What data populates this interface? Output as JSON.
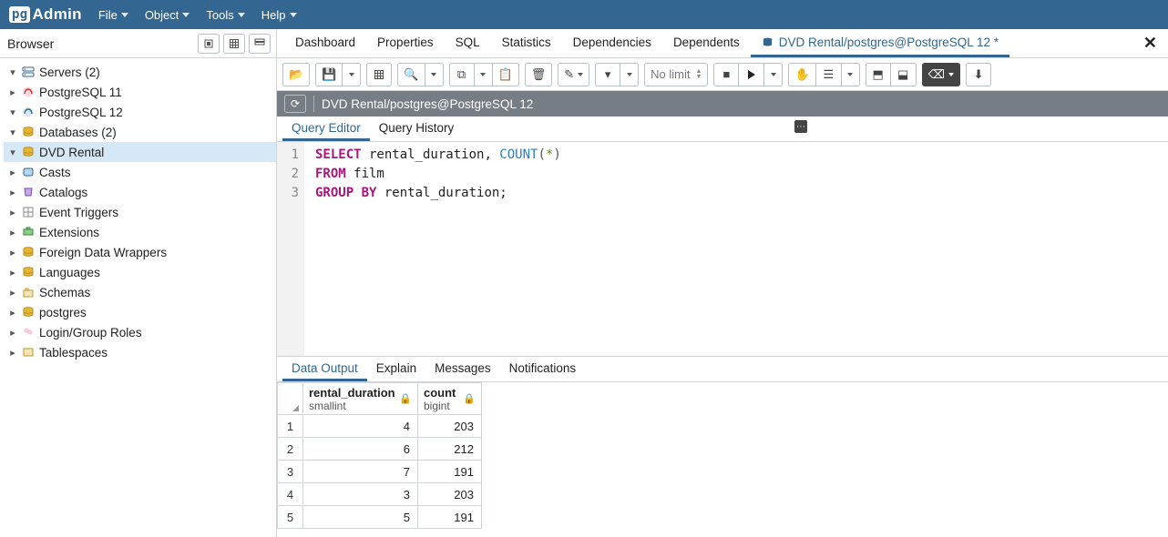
{
  "menubar": {
    "logo_prefix": "pg",
    "logo_suffix": "Admin",
    "items": [
      "File",
      "Object",
      "Tools",
      "Help"
    ]
  },
  "sidebar": {
    "title": "Browser",
    "tree": [
      {
        "lv": 0,
        "toggle": "▾",
        "icon": "servers",
        "label": "Servers (2)"
      },
      {
        "lv": 1,
        "toggle": "▸",
        "icon": "elephant-red",
        "label": "PostgreSQL 11"
      },
      {
        "lv": 1,
        "toggle": "▾",
        "icon": "elephant-blue",
        "label": "PostgreSQL 12"
      },
      {
        "lv": 2,
        "toggle": "▾",
        "icon": "db-group",
        "label": "Databases (2)"
      },
      {
        "lv": 3,
        "toggle": "▾",
        "icon": "db-gold",
        "label": "DVD Rental",
        "selected": true
      },
      {
        "lv": 4,
        "toggle": "▸",
        "icon": "casts",
        "label": "Casts"
      },
      {
        "lv": 4,
        "toggle": "▸",
        "icon": "catalogs",
        "label": "Catalogs"
      },
      {
        "lv": 4,
        "toggle": "▸",
        "icon": "event-trig",
        "label": "Event Triggers"
      },
      {
        "lv": 4,
        "toggle": "▸",
        "icon": "ext",
        "label": "Extensions"
      },
      {
        "lv": 4,
        "toggle": "▸",
        "icon": "fdw",
        "label": "Foreign Data Wrappers"
      },
      {
        "lv": 4,
        "toggle": "▸",
        "icon": "lang",
        "label": "Languages"
      },
      {
        "lv": 4,
        "toggle": "▸",
        "icon": "schema",
        "label": "Schemas"
      },
      {
        "lv": 3,
        "toggle": "▸",
        "icon": "db-gold",
        "label": "postgres"
      },
      {
        "lv": 2,
        "toggle": "▸",
        "icon": "roles",
        "label": "Login/Group Roles"
      },
      {
        "lv": 2,
        "toggle": "▸",
        "icon": "tablespace",
        "label": "Tablespaces"
      }
    ]
  },
  "main_tabs": [
    {
      "label": "Dashboard"
    },
    {
      "label": "Properties"
    },
    {
      "label": "SQL"
    },
    {
      "label": "Statistics"
    },
    {
      "label": "Dependencies"
    },
    {
      "label": "Dependents"
    },
    {
      "label": "DVD Rental/postgres@PostgreSQL 12 *",
      "icon": true,
      "active": true
    }
  ],
  "toolbar": {
    "limit_label": "No limit"
  },
  "connection_bar": {
    "path": "DVD Rental/postgres@PostgreSQL 12"
  },
  "editor_tabs": [
    {
      "label": "Query Editor",
      "active": true
    },
    {
      "label": "Query History"
    }
  ],
  "editor": {
    "line_numbers": [
      "1",
      "2",
      "3"
    ],
    "lines": [
      [
        {
          "t": "SELECT",
          "c": "kw"
        },
        {
          "t": " rental_duration, "
        },
        {
          "t": "COUNT",
          "c": "fn"
        },
        {
          "t": "(",
          "c": "par"
        },
        {
          "t": "*",
          "c": "op"
        },
        {
          "t": ")",
          "c": "par"
        }
      ],
      [
        {
          "t": "FROM",
          "c": "kw"
        },
        {
          "t": " film"
        }
      ],
      [
        {
          "t": "GROUP BY",
          "c": "kw"
        },
        {
          "t": " rental_duration;"
        }
      ]
    ]
  },
  "output_tabs": [
    {
      "label": "Data Output",
      "active": true
    },
    {
      "label": "Explain"
    },
    {
      "label": "Messages"
    },
    {
      "label": "Notifications"
    }
  ],
  "results": {
    "columns": [
      {
        "name": "rental_duration",
        "type": "smallint"
      },
      {
        "name": "count",
        "type": "bigint"
      }
    ],
    "rows": [
      {
        "n": 1,
        "rental_duration": 4,
        "count": 203
      },
      {
        "n": 2,
        "rental_duration": 6,
        "count": 212
      },
      {
        "n": 3,
        "rental_duration": 7,
        "count": 191
      },
      {
        "n": 4,
        "rental_duration": 3,
        "count": 203
      },
      {
        "n": 5,
        "rental_duration": 5,
        "count": 191
      }
    ]
  }
}
